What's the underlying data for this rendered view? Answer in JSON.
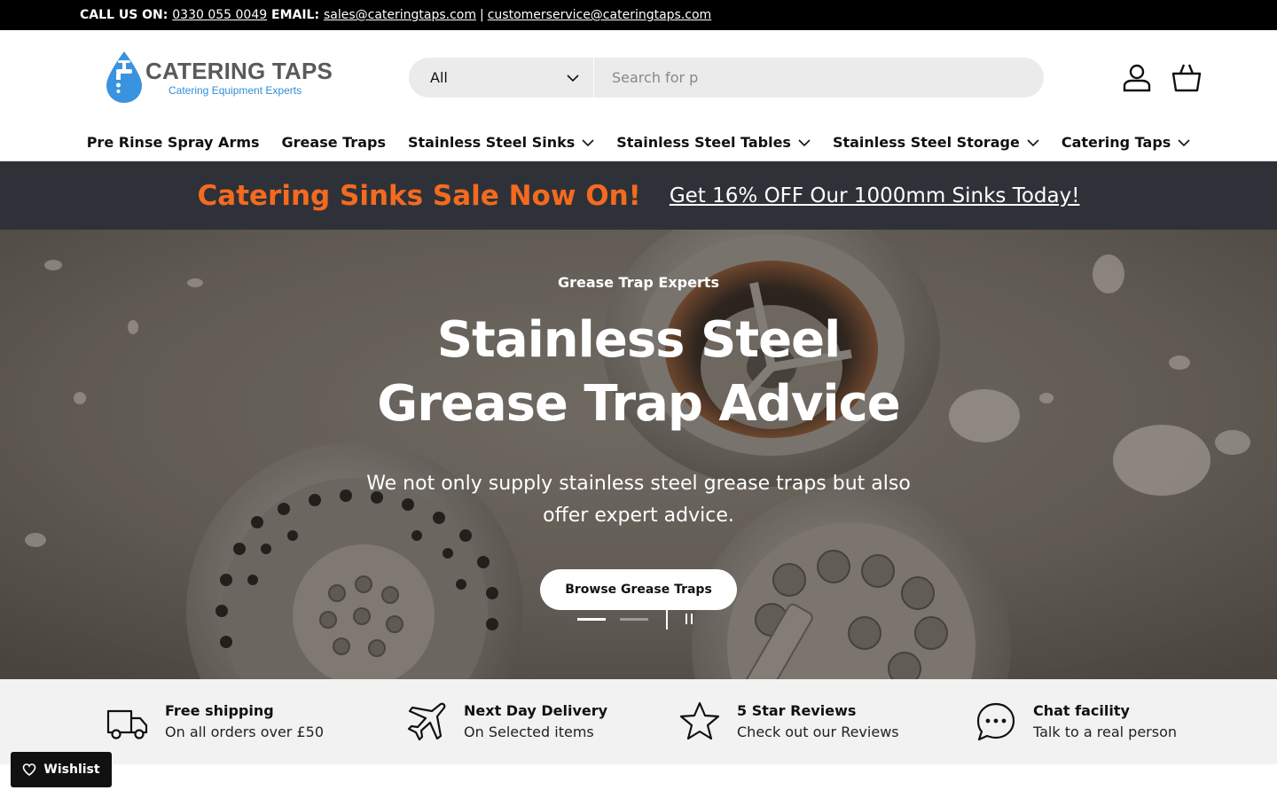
{
  "topbar": {
    "call_label": "CALL US ON:",
    "phone": "0330 055 0049",
    "email_label": "EMAIL:",
    "email_sales": "sales@cateringtaps.com",
    "separator": "|",
    "email_service": "customerservice@cateringtaps.com"
  },
  "logo": {
    "title": "CATERING TAPS",
    "subtitle": "Catering Equipment Experts"
  },
  "search": {
    "category": "All",
    "placeholder": "Search for p"
  },
  "nav": [
    {
      "label": "Pre Rinse Spray Arms",
      "dropdown": false
    },
    {
      "label": "Grease Traps",
      "dropdown": false
    },
    {
      "label": "Stainless Steel Sinks",
      "dropdown": true
    },
    {
      "label": "Stainless Steel Tables",
      "dropdown": true
    },
    {
      "label": "Stainless Steel Storage",
      "dropdown": true
    },
    {
      "label": "Catering Taps",
      "dropdown": true
    }
  ],
  "promo": {
    "headline": "Catering Sinks Sale Now On!",
    "link": "Get 16% OFF Our 1000mm Sinks Today!",
    "headline_color": "#f46a1f",
    "background": "#2e3238"
  },
  "hero": {
    "kicker": "Grease Trap Experts",
    "title": "Stainless Steel Grease Trap Advice",
    "description": "We not only supply stainless steel grease traps but also offer expert advice.",
    "button": "Browse Grease Traps",
    "slides": 2,
    "active_slide": 1
  },
  "features": [
    {
      "icon": "truck-icon",
      "title": "Free shipping",
      "subtitle": "On all orders over £50"
    },
    {
      "icon": "plane-icon",
      "title": "Next Day Delivery",
      "subtitle": "On Selected items"
    },
    {
      "icon": "star-icon",
      "title": "5 Star Reviews",
      "subtitle": "Check out our Reviews"
    },
    {
      "icon": "chat-icon",
      "title": "Chat facility",
      "subtitle": "Talk to a real person"
    }
  ],
  "wishlist": {
    "label": "Wishlist"
  }
}
